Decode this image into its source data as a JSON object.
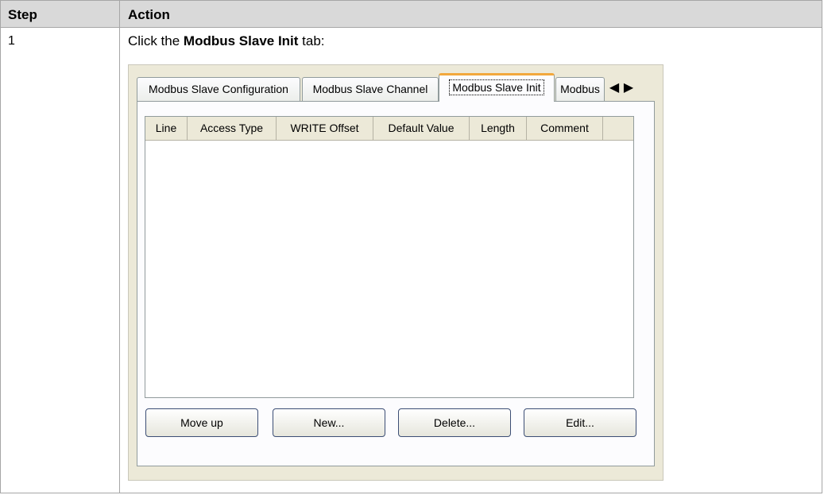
{
  "table": {
    "header": {
      "step": "Step",
      "action": "Action"
    },
    "rows": [
      {
        "step": "1",
        "instruction_prefix": "Click the ",
        "instruction_bold": "Modbus Slave Init",
        "instruction_suffix": " tab:"
      }
    ]
  },
  "screenshot": {
    "tabs": [
      {
        "label": "Modbus Slave Configuration",
        "active": false
      },
      {
        "label": "Modbus Slave Channel",
        "active": false
      },
      {
        "label": "Modbus Slave Init",
        "active": true
      },
      {
        "label": "Modbus",
        "active": false
      }
    ],
    "tab_nav": {
      "prev_icon": "triangle-left-icon",
      "next_icon": "triangle-right-icon"
    },
    "grid_columns": [
      "Line",
      "Access Type",
      "WRITE Offset",
      "Default Value",
      "Length",
      "Comment",
      ""
    ],
    "grid_rows": [],
    "buttons": {
      "move_up": "Move up",
      "new": "New...",
      "delete": "Delete...",
      "edit": "Edit..."
    },
    "colors": {
      "active_tab_accent": "#f2a83c",
      "dialog_background": "#ece9d8",
      "button_border": "#3c4e75"
    }
  }
}
